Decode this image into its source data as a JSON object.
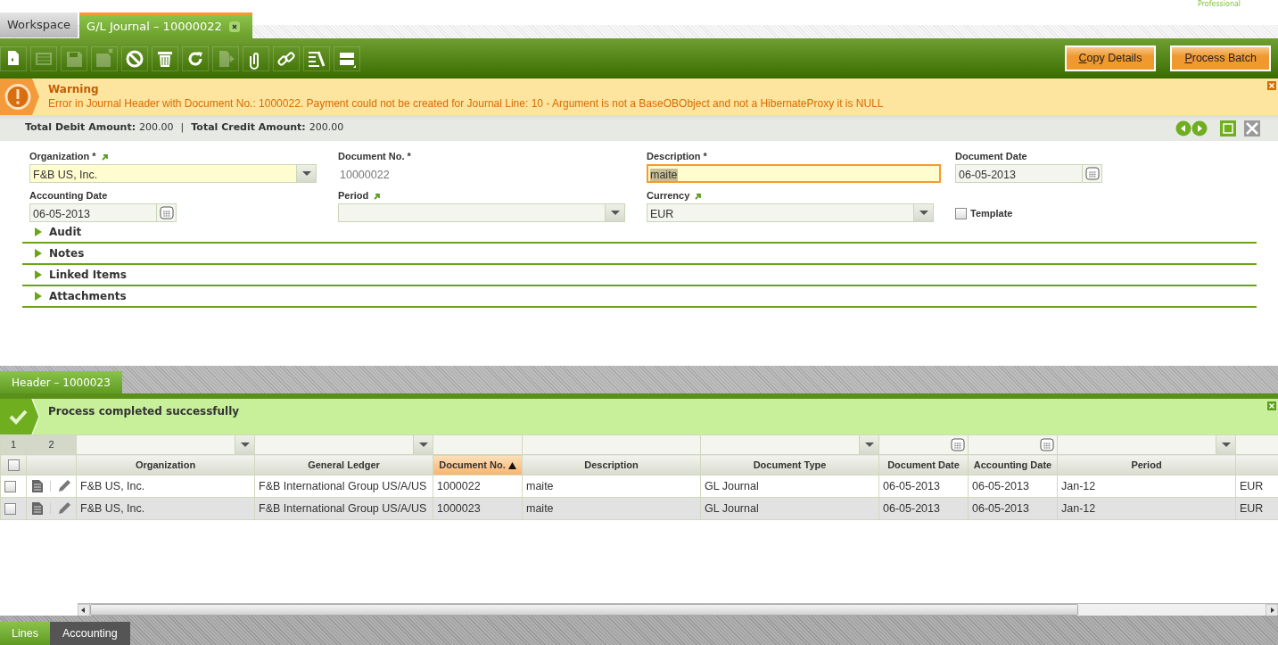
{
  "logo": {
    "tagline": "Professional"
  },
  "tabs": [
    {
      "label": "Workspace",
      "selected": false,
      "closable": false
    },
    {
      "label": "G/L Journal – 10000022",
      "selected": true,
      "closable": true
    }
  ],
  "toolbar": {
    "icons": [
      {
        "kind": "new",
        "disabled": false
      },
      {
        "kind": "grid",
        "disabled": true
      },
      {
        "kind": "save",
        "disabled": true
      },
      {
        "kind": "save-close",
        "disabled": true
      },
      {
        "kind": "cancel",
        "disabled": false
      },
      {
        "kind": "delete",
        "disabled": false
      },
      {
        "kind": "refresh",
        "disabled": false
      },
      {
        "kind": "export",
        "disabled": true
      },
      {
        "kind": "attach",
        "disabled": false
      },
      {
        "kind": "link",
        "disabled": false
      },
      {
        "kind": "tools",
        "disabled": false
      },
      {
        "kind": "layout",
        "disabled": false
      }
    ],
    "buttons": [
      {
        "label": "Copy Details"
      },
      {
        "label": "Process Batch"
      }
    ]
  },
  "warning": {
    "title": "Warning",
    "message": "Error in Journal Header with Document No.: 1000022. Payment could not be created for Journal Line: 10 - Argument is not a BaseOBObject and not a HibernateProxy it is NULL"
  },
  "totals": [
    {
      "label": "Total Debit Amount:",
      "value": "200.00"
    },
    {
      "label": "Total Credit Amount:",
      "value": "200.00"
    }
  ],
  "totals_separator": "|",
  "form": {
    "fields": [
      {
        "label": "Organization *",
        "kind": "select",
        "value": "F&B US, Inc.",
        "link": true,
        "mandatory": true,
        "focused": false
      },
      {
        "label": "Document No. *",
        "kind": "readonly",
        "value": "10000022",
        "link": false
      },
      {
        "label": "Description *",
        "kind": "text",
        "value": "maite",
        "link": false,
        "mandatory": true,
        "focused": true
      },
      {
        "label": "Document Date",
        "kind": "date",
        "value": "06-05-2013",
        "link": false,
        "mandatory": false,
        "focused": false
      },
      {
        "label": "Accounting Date",
        "kind": "date",
        "value": "06-05-2013",
        "link": false,
        "mandatory": false,
        "focused": false
      },
      {
        "label": "Period",
        "kind": "select",
        "link": true,
        "mandatory": false,
        "focused": false
      },
      {
        "label": "Currency",
        "kind": "select",
        "value": "EUR",
        "link": true,
        "mandatory": false,
        "focused": false
      },
      {
        "label": "Template",
        "kind": "checkbox",
        "checked": false
      }
    ],
    "sections": [
      {
        "label": "Audit",
        "expanded": false
      },
      {
        "label": "Notes",
        "expanded": false
      },
      {
        "label": "Linked Items",
        "expanded": false
      },
      {
        "label": "Attachments",
        "expanded": false
      }
    ]
  },
  "subtab": {
    "label": "Header – 1000023",
    "selected": true
  },
  "success": {
    "message": "Process completed successfully"
  },
  "grid": {
    "corner_labels": [
      "1",
      "2"
    ],
    "all_checked": false,
    "columns": [
      {
        "label": "Organization",
        "kind": "select",
        "sorted": false
      },
      {
        "label": "General Ledger",
        "kind": "select",
        "sorted": false
      },
      {
        "label": "Document No.",
        "kind": "text",
        "sorted": true
      },
      {
        "label": "Description",
        "kind": "text",
        "sorted": false
      },
      {
        "label": "Document Type",
        "kind": "select",
        "sorted": false
      },
      {
        "label": "Document Date",
        "kind": "date",
        "sorted": false
      },
      {
        "label": "Accounting Date",
        "kind": "date",
        "sorted": false
      },
      {
        "label": "Period",
        "kind": "select",
        "sorted": false
      },
      {
        "kind": "text",
        "sorted": false
      }
    ],
    "rows": [
      {
        "selected": false,
        "checked": false,
        "cells": [
          "F&B US, Inc.",
          "F&B International Group US/A/US",
          "1000022",
          "maite",
          "GL Journal",
          "06-05-2013",
          "06-05-2013",
          "Jan-12",
          "EUR"
        ]
      },
      {
        "selected": true,
        "checked": false,
        "cells": [
          "F&B US, Inc.",
          "F&B International Group US/A/US",
          "1000023",
          "maite",
          "GL Journal",
          "06-05-2013",
          "06-05-2013",
          "Jan-12",
          "EUR"
        ]
      }
    ]
  },
  "bottom_tabs": [
    {
      "label": "Lines",
      "selected": true
    },
    {
      "label": "Accounting",
      "selected": false
    }
  ]
}
